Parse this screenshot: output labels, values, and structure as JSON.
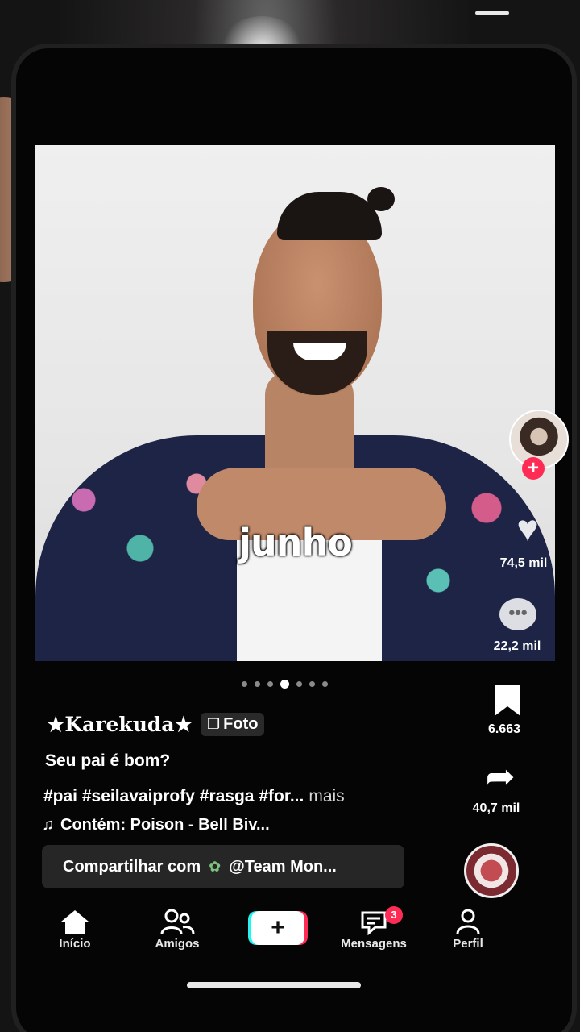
{
  "post": {
    "overlay_text": "junho",
    "author": "★Karekuda★",
    "type_badge": "Foto",
    "title": "Seu pai é bom?",
    "hashtags": "#pai #seilavaiprofy #rasga #for...",
    "more": "mais",
    "music": "Contém: Poison - Bell Biv...",
    "share_prompt": "Compartilhar com",
    "share_target": "@Team Mon...",
    "carousel": {
      "total": 7,
      "active_index": 3
    }
  },
  "rail": {
    "likes": "74,5 mil",
    "comments": "22,2 mil",
    "saves": "6.663",
    "shares": "40,7 mil"
  },
  "nav": {
    "home": "Início",
    "friends": "Amigos",
    "create": "+",
    "messages": "Mensagens",
    "messages_badge": "3",
    "profile": "Perfil"
  },
  "icons": {
    "home": "home-icon",
    "friends": "friends-icon",
    "messages": "inbox-icon",
    "profile": "profile-icon",
    "like": "heart-icon",
    "comment": "comment-icon",
    "save": "bookmark-icon",
    "share": "share-arrow-icon",
    "music": "music-note-icon"
  },
  "colors": {
    "accent_red": "#fe2c55",
    "accent_cyan": "#25f4ee",
    "background": "#050505"
  }
}
